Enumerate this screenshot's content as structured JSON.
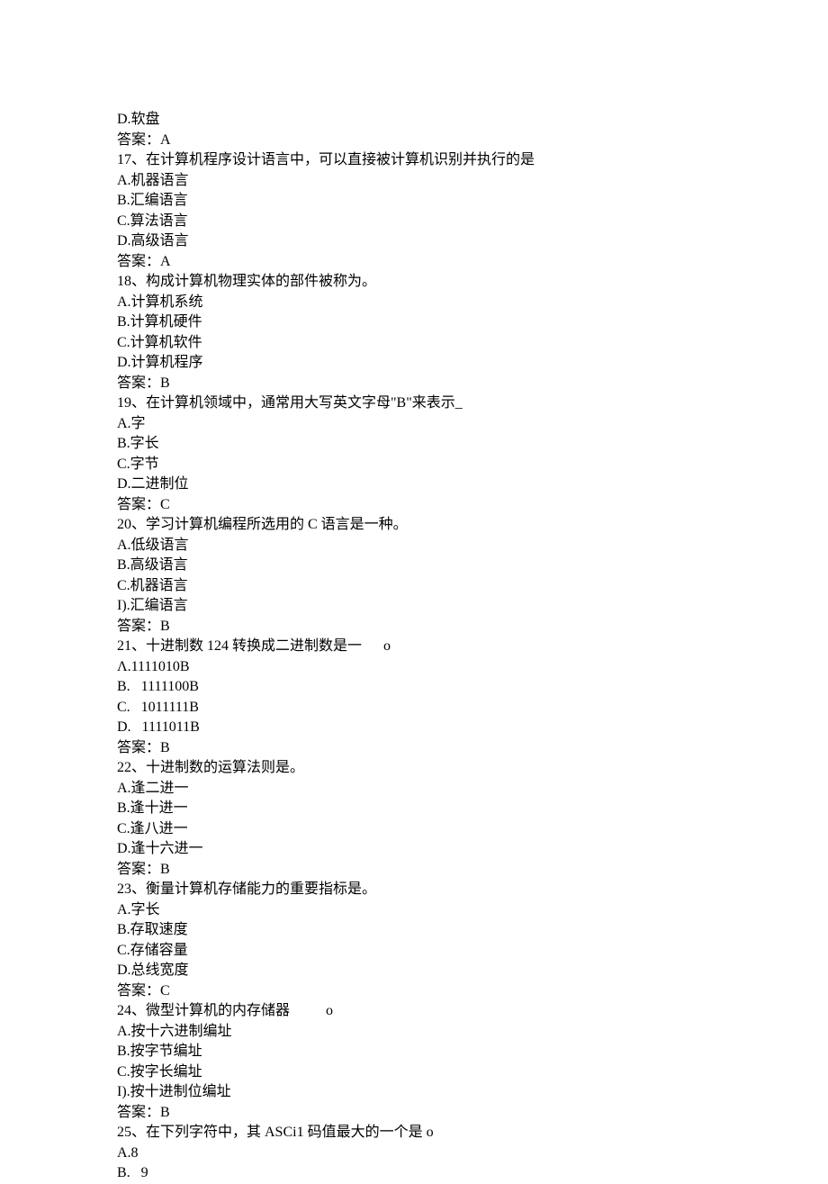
{
  "lines": [
    "D.软盘",
    "答案：A",
    "17、在计算机程序设计语言中，可以直接被计算机识别并执行的是",
    "A.机器语言",
    "B.汇编语言",
    "C.算法语言",
    "D.高级语言",
    "答案：A",
    "18、构成计算机物理实体的部件被称为。",
    "A.计算机系统",
    "B.计算机硬件",
    "C.计算机软件",
    "D.计算机程序",
    "答案：B",
    "19、在计算机领域中，通常用大写英文字母\"B\"来表示_",
    "A.字",
    "B.字长",
    "C.字节",
    "D.二进制位",
    "答案：C",
    "20、学习计算机编程所选用的 C 语言是一种。",
    "A.低级语言",
    "B.高级语言",
    "C.机器语言",
    "I).汇编语言",
    "答案：B",
    "21、十进制数 124 转换成二进制数是一      o",
    "Λ.1111010B",
    "B.   1111100B",
    "C.   1011111B",
    "D.   1111011B",
    "答案：B",
    "22、十进制数的运算法则是。",
    "A.逢二进一",
    "B.逢十进一",
    "C.逢八进一",
    "D.逢十六进一",
    "答案：B",
    "23、衡量计算机存储能力的重要指标是。",
    "A.字长",
    "B.存取速度",
    "C.存储容量",
    "D.总线宽度",
    "答案：C",
    "24、微型计算机的内存储器          o",
    "A.按十六进制编址",
    "B.按字节编址",
    "C.按字长编址",
    "I).按十进制位编址",
    "答案：B",
    "25、在下列字符中，其 ASCi1 码值最大的一个是 o",
    "A.8",
    "B.   9"
  ]
}
